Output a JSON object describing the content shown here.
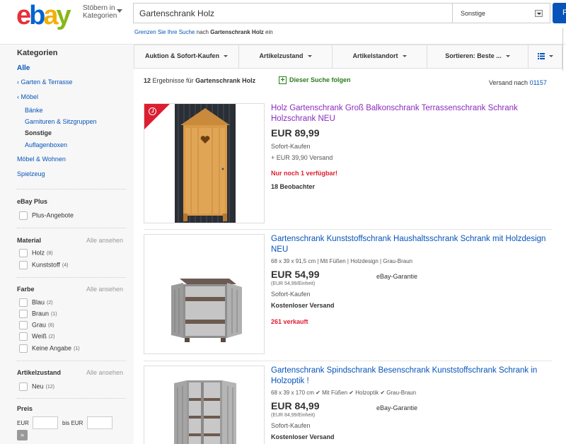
{
  "header": {
    "logo": {
      "e": "e",
      "b": "b",
      "a": "a",
      "y": "y"
    },
    "browse_label": "Stöbern in Kategorien",
    "search_value": "Gartenschrank Holz",
    "category_value": "Sonstige",
    "search_button_label": "F",
    "refine": {
      "link": "Grenzen Sie Ihre Suche",
      "middle": "nach",
      "query": "Gartenschrank Holz",
      "suffix": "ein"
    }
  },
  "sidebar": {
    "categories_heading": "Kategorien",
    "all": "Alle",
    "garden": "‹ Garten & Terrasse",
    "furniture": "‹ Möbel",
    "sub": [
      "Bänke",
      "Garnituren & Sitzgruppen",
      "Sonstige",
      "Auflagenboxen"
    ],
    "living": "Möbel & Wohnen",
    "toys": "Spielzeug",
    "ebay_plus": {
      "heading": "eBay Plus",
      "option": "Plus-Angebote"
    },
    "see_all": "Alle ansehen",
    "material": {
      "heading": "Material",
      "options": [
        {
          "label": "Holz",
          "count": "(8)"
        },
        {
          "label": "Kunststoff",
          "count": "(4)"
        }
      ]
    },
    "color": {
      "heading": "Farbe",
      "options": [
        {
          "label": "Blau",
          "count": "(2)"
        },
        {
          "label": "Braun",
          "count": "(1)"
        },
        {
          "label": "Grau",
          "count": "(6)"
        },
        {
          "label": "Weiß",
          "count": "(2)"
        },
        {
          "label": "Keine Angabe",
          "count": "(1)"
        }
      ]
    },
    "condition": {
      "heading": "Artikelzustand",
      "options": [
        {
          "label": "Neu",
          "count": "(12)"
        }
      ]
    },
    "price": {
      "heading": "Preis",
      "from_label": "EUR",
      "to_label": "bis EUR",
      "go": "»"
    }
  },
  "filter_bar": {
    "items": [
      "Auktion & Sofort-Kaufen",
      "Artikelzustand",
      "Artikelstandort",
      "Sortieren: Beste ..."
    ],
    "view_icon": "list-view-icon"
  },
  "results": {
    "count": "12",
    "count_text": "Ergebnisse für",
    "query": "Gartenschrank Holz",
    "follow": "Dieser Suche folgen",
    "ship_to_label": "Versand nach",
    "zip": "01157"
  },
  "items": [
    {
      "title": "Holz Gartenschrank Groß Balkonschrank Terrassenschrank Schrank Holzschrank NEU",
      "price": "EUR 89,99",
      "format": "Sofort-Kaufen",
      "shipping": "+ EUR 39,90 Versand",
      "availability": "Nur noch 1 verfügbar!",
      "watchers": "18 Beobachter"
    },
    {
      "title": "Gartenschrank Kunststoffschrank Haushaltsschrank Schrank mit Holzdesign NEU",
      "attrs": "68 x 39 x 91,5 cm | Mit Füßen | Holzdesign | Grau-Braun",
      "price": "EUR 54,99",
      "unit_price": "(EUR 54,99/Einheit)",
      "guarantee": "eBay-Garantie",
      "format": "Sofort-Kaufen",
      "shipping": "Kostenloser Versand",
      "sold": "261 verkauft"
    },
    {
      "title": "Gartenschrank Spindschrank Besenschrank Kunststoffschrank Schrank in Holzoptik !",
      "attrs": "68 x 39 x 170 cm ✔ Mit Füßen ✔ Holzoptik ✔ Grau-Braun",
      "price": "EUR 84,99",
      "unit_price": "(EUR 84,99/Einheit)",
      "guarantee": "eBay-Garantie",
      "format": "Sofort-Kaufen",
      "shipping": "Kostenloser Versand"
    }
  ],
  "colors": {
    "link": "#0654ba",
    "visited": "#8b2bbf",
    "urgent": "#dd1e31",
    "follow": "#2a7d18"
  }
}
